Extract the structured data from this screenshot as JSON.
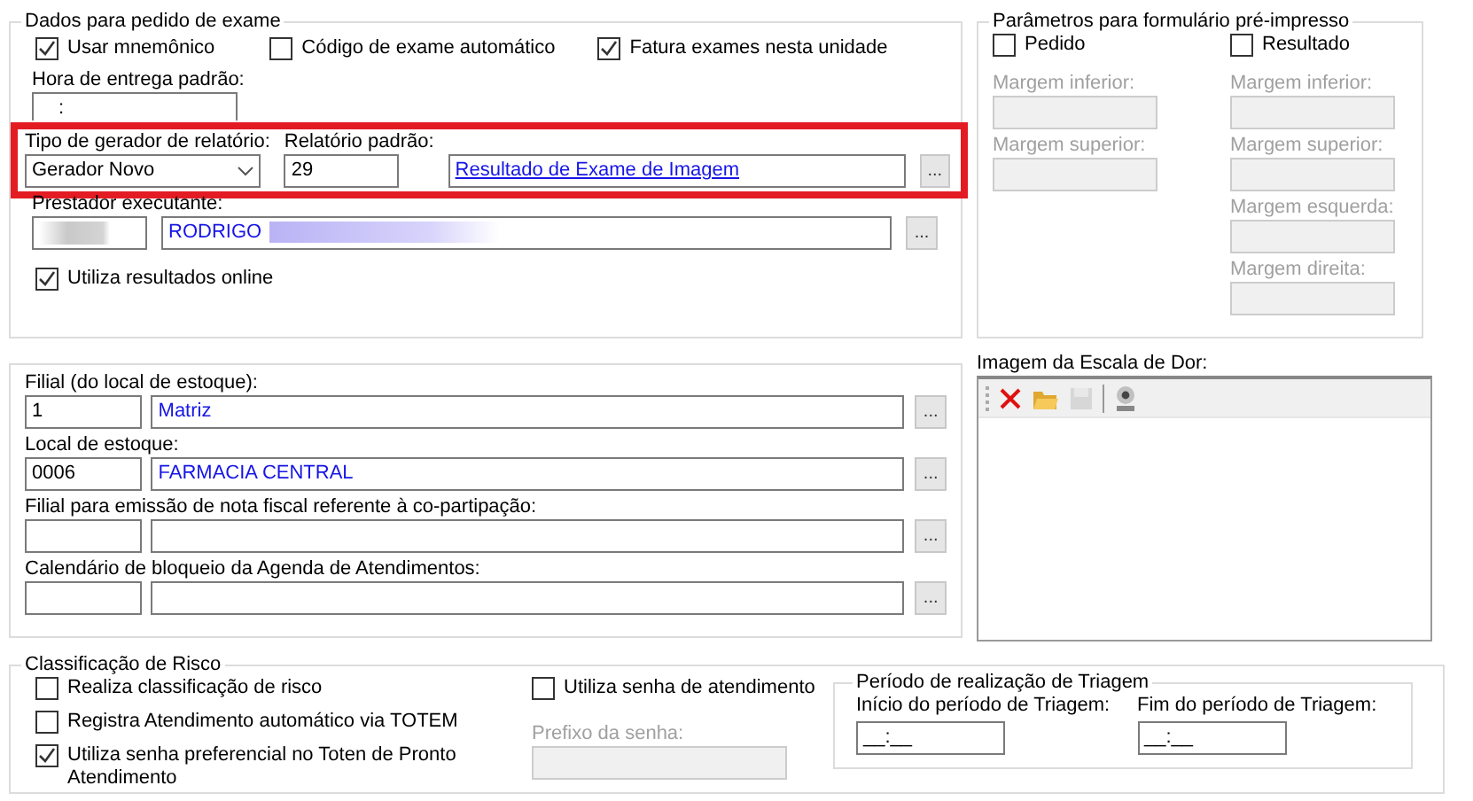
{
  "exam_order": {
    "title": "Dados para pedido de exame",
    "checkboxes": [
      {
        "label": "Usar mnemônico",
        "checked": true
      },
      {
        "label": "Código de exame automático",
        "checked": false
      },
      {
        "label": "Fatura exames nesta unidade",
        "checked": true
      }
    ],
    "delivery_time": {
      "label": "Hora de entrega padrão:",
      "value": ":"
    },
    "report_generator": {
      "label": "Tipo de gerador de relatório:",
      "value": "Gerador Novo"
    },
    "default_report": {
      "label": "Relatório padrão:",
      "code": "29",
      "name": "Resultado de Exame de Imagem",
      "button": "..."
    },
    "provider": {
      "label": "Prestador executante:",
      "name": "RODRIGO",
      "button": "..."
    },
    "online_results": {
      "label": "Utiliza resultados online",
      "checked": true
    }
  },
  "preprinted_form": {
    "title": "Parâmetros para formulário pré-impresso",
    "columns": [
      {
        "label": "Pedido",
        "checked": false,
        "fields": [
          {
            "label": "Margem inferior:",
            "disabled": true
          },
          {
            "label": "Margem superior:",
            "disabled": true
          }
        ]
      },
      {
        "label": "Resultado",
        "checked": false,
        "fields": [
          {
            "label": "Margem inferior:",
            "disabled": true
          },
          {
            "label": "Margem superior:",
            "disabled": true
          },
          {
            "label": "Margem esquerda:",
            "disabled": true
          },
          {
            "label": "Margem direita:",
            "disabled": true
          }
        ]
      }
    ]
  },
  "stock": {
    "fields": [
      {
        "label": "Filial (do local de estoque):",
        "code": "1",
        "name": "Matriz",
        "button": "..."
      },
      {
        "label": "Local de estoque:",
        "code": "0006",
        "name": "FARMACIA CENTRAL",
        "button": "..."
      },
      {
        "label": "Filial para emissão de nota fiscal referente à co-partipação:",
        "button": "..."
      },
      {
        "label": "Calendário de bloqueio da Agenda de Atendimentos:",
        "button": "..."
      }
    ]
  },
  "pain_scale": {
    "label": "Imagem da Escala de Dor:",
    "toolbar": [
      {
        "kind": "delete",
        "disabled": false
      },
      {
        "kind": "open",
        "disabled": false
      },
      {
        "kind": "save",
        "disabled": true
      },
      {
        "kind": "webcam",
        "disabled": false
      }
    ]
  },
  "risk": {
    "title": "Classificação de Risco",
    "checkboxes": [
      {
        "label": "Realiza classificação de risco",
        "checked": false
      },
      {
        "label": "Registra Atendimento automático via TOTEM",
        "checked": false
      },
      {
        "label": "Utiliza senha preferencial no Toten de Pronto Atendimento",
        "checked": true
      }
    ],
    "password": {
      "label": "Utiliza senha de atendimento",
      "checked": false
    },
    "prefix": {
      "label": "Prefixo da senha:",
      "disabled": true
    },
    "triage": {
      "title": "Período de realização de Triagem",
      "fields": [
        {
          "label": "Início do período de Triagem:",
          "value": "__:__"
        },
        {
          "label": "Fim do período de Triagem:",
          "value": "__:__"
        }
      ]
    }
  }
}
